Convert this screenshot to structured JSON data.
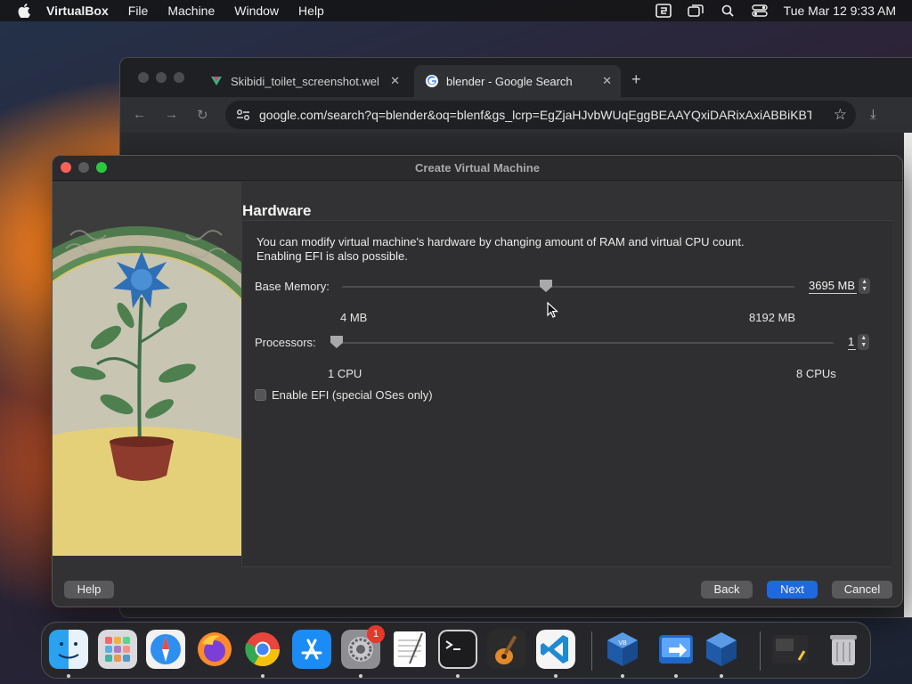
{
  "menubar": {
    "app_name": "VirtualBox",
    "items": [
      "File",
      "Machine",
      "Window",
      "Help"
    ],
    "clock": "Tue Mar 12  9:33 AM"
  },
  "browser": {
    "tabs": [
      {
        "title": "Skibidi_toilet_screenshot.webp"
      },
      {
        "title": "blender - Google Search"
      }
    ],
    "url": "google.com/search?q=blender&oq=blenf&gs_lcrp=EgZjaHJvbWUqEggBEAAYQxiDARixAxiABBiKBTIGCAAQRRg5MhIIARAAGEMYgwEYsQMYgAQYigUyDwgCEAAYQxixAxiABBiKBTIGCAMQRRg9"
  },
  "dialog": {
    "title": "Create Virtual Machine",
    "section_title": "Hardware",
    "description_line1": "You can modify virtual machine's hardware by changing amount of RAM and virtual CPU count.",
    "description_line2": "Enabling EFI is also possible.",
    "memory": {
      "label": "Base Memory:",
      "value": "3695 MB",
      "value_mb": 3695,
      "min_label": "4 MB",
      "max_label": "8192 MB",
      "min": 4,
      "max": 8192
    },
    "processors": {
      "label": "Processors:",
      "value": "1",
      "value_num": 1,
      "min_label": "1 CPU",
      "max_label": "8 CPUs",
      "min": 1,
      "max": 8
    },
    "efi": {
      "label": "Enable EFI (special OSes only)",
      "checked": false
    },
    "buttons": {
      "help": "Help",
      "back": "Back",
      "next": "Next",
      "cancel": "Cancel"
    }
  },
  "dock": {
    "apps": [
      "finder",
      "launchpad",
      "safari",
      "firefox",
      "chrome",
      "app-store",
      "system-settings",
      "textedit",
      "terminal",
      "garageband",
      "vscode",
      "virtualbox",
      "migration-assistant",
      "virtualbox-vm",
      "screenshot-folder",
      "trash"
    ],
    "settings_badge": "1"
  },
  "colors": {
    "accent": "#1f69e0",
    "close": "#fe5f57",
    "zoom": "#29c840",
    "badge": "#e8372c"
  }
}
